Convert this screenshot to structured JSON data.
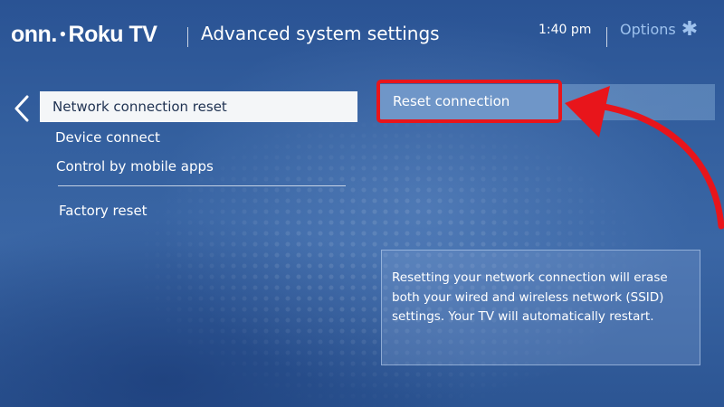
{
  "header": {
    "brand_onn": "onn.",
    "brand_sep": "●",
    "brand_roku": "Roku TV",
    "title": "Advanced system settings",
    "time": "1:40 pm",
    "options_label": "Options",
    "options_icon": "✱"
  },
  "menu": {
    "back_icon": "chevron-left",
    "items": [
      {
        "label": "Network connection reset",
        "selected": true
      },
      {
        "label": "Device connect"
      },
      {
        "label": "Control by mobile apps"
      },
      {
        "label": "Factory reset"
      }
    ]
  },
  "detail": {
    "button_label": "Reset connection",
    "description": "Resetting your network connection will erase both your wired and wireless network (SSID) settings. Your TV will automatically restart."
  },
  "annotation": {
    "color": "#e8151b"
  }
}
